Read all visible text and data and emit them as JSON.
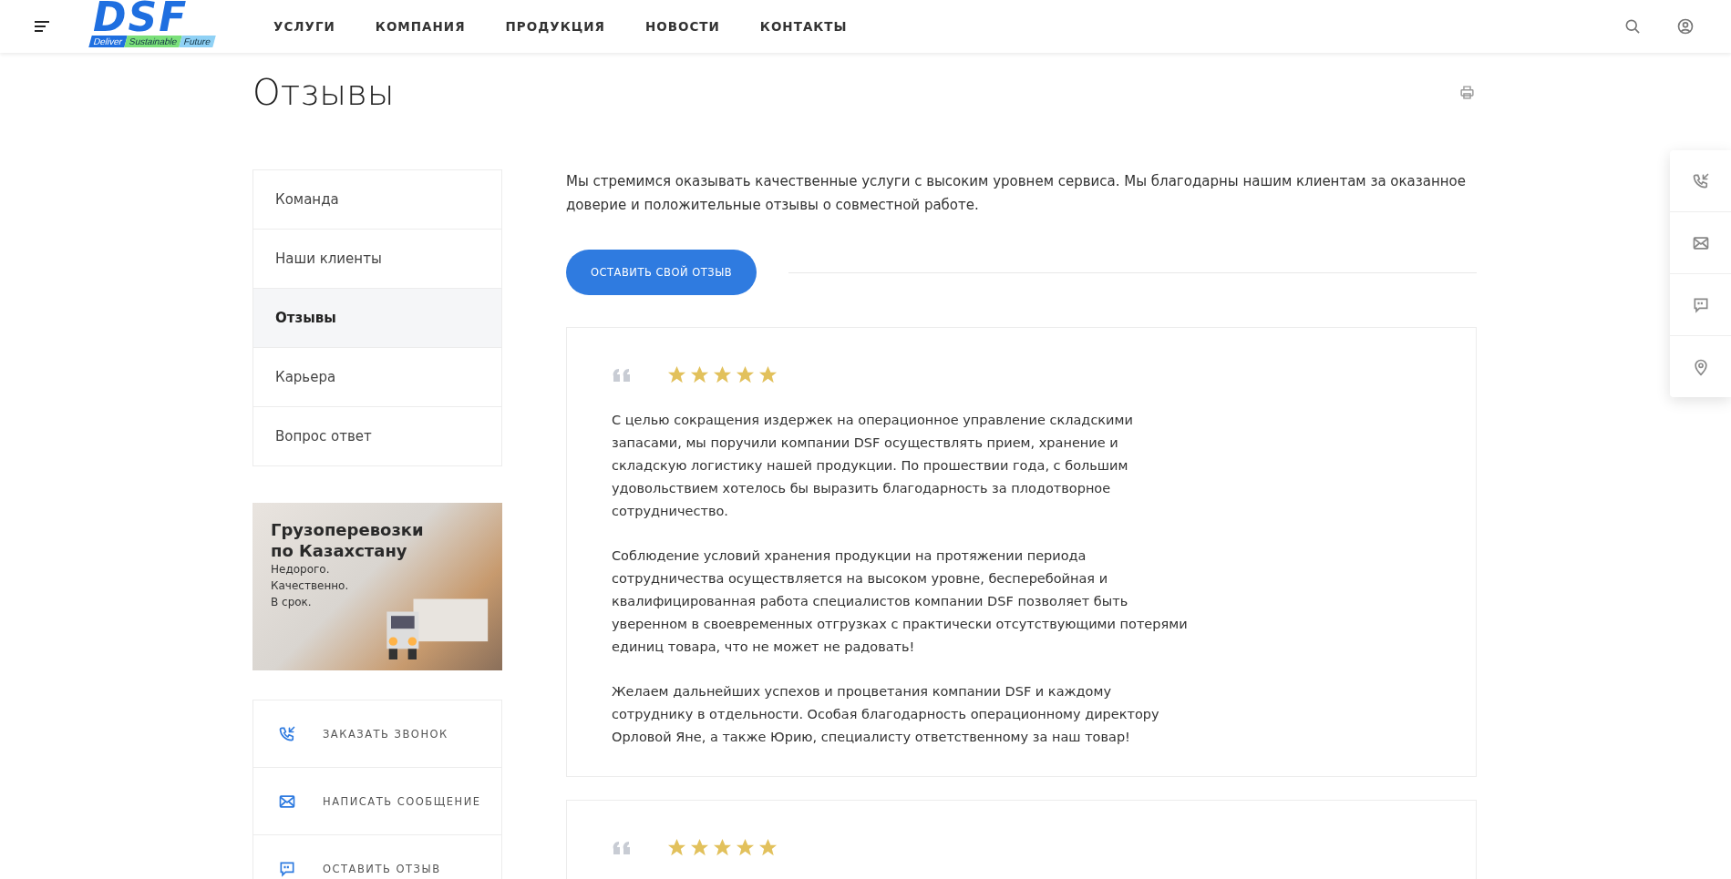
{
  "header": {
    "logo": {
      "mark": "DSF",
      "tagline": [
        "Deliver",
        "Sustainable",
        "Future"
      ]
    },
    "nav": [
      {
        "label": "УСЛУГИ"
      },
      {
        "label": "КОМПАНИЯ"
      },
      {
        "label": "ПРОДУКЦИЯ"
      },
      {
        "label": "НОВОСТИ"
      },
      {
        "label": "КОНТАКТЫ"
      }
    ]
  },
  "page_title": "Отзывы",
  "sidebar": {
    "items": [
      {
        "label": "Команда",
        "selected": false
      },
      {
        "label": "Наши клиенты",
        "selected": false
      },
      {
        "label": "Отзывы",
        "selected": true
      },
      {
        "label": "Карьера",
        "selected": false
      },
      {
        "label": "Вопрос ответ",
        "selected": false
      }
    ],
    "banner": {
      "title": "Грузоперевозки по Казахстану",
      "lines": [
        "Недорого.",
        "Качественно.",
        "В срок."
      ]
    },
    "contacts": [
      {
        "kind": "callback",
        "label": "ЗАКАЗАТЬ ЗВОНОК"
      },
      {
        "kind": "message",
        "label": "НАПИСАТЬ СООБЩЕНИЕ"
      },
      {
        "kind": "review",
        "label": "ОСТАВИТЬ ОТЗЫВ"
      }
    ]
  },
  "intro": "Мы стремимся оказывать качественные услуги с высоким уровнем сервиса. Мы благодарны нашим клиентам за оказанное доверие и положительные отзывы о совместной работе.",
  "review_button": "ОСТАВИТЬ СВОЙ ОТЗЫВ",
  "reviews": [
    {
      "stars": 5,
      "paragraphs": [
        "С целью сокращения издержек на операционное управление складскими запасами, мы поручили компании DSF осуществлять прием, хранение и складскую логистику нашей продукции. По прошествии года, с большим удовольствием хотелось бы выразить благодарность за плодотворное сотрудничество.",
        "Соблюдение условий хранения продукции на протяжении периода сотрудничества осуществляется на высоком уровне, бесперебойная и квалифицированная работа специалистов компании DSF позволяет быть уверенном в своевременных отгрузках с практически отсутствующими потерями единиц товара, что не может не радовать!",
        "Желаем дальнейших успехов и процветания компании DSF и каждому сотруднику в отдельности. Особая благодарность операционному директору Орловой Яне, а также Юрию, специалисту ответственному за наш товар!"
      ]
    },
    {
      "stars": 5
    }
  ],
  "side_panel": [
    {
      "kind": "callback"
    },
    {
      "kind": "message"
    },
    {
      "kind": "review"
    },
    {
      "kind": "location"
    }
  ]
}
